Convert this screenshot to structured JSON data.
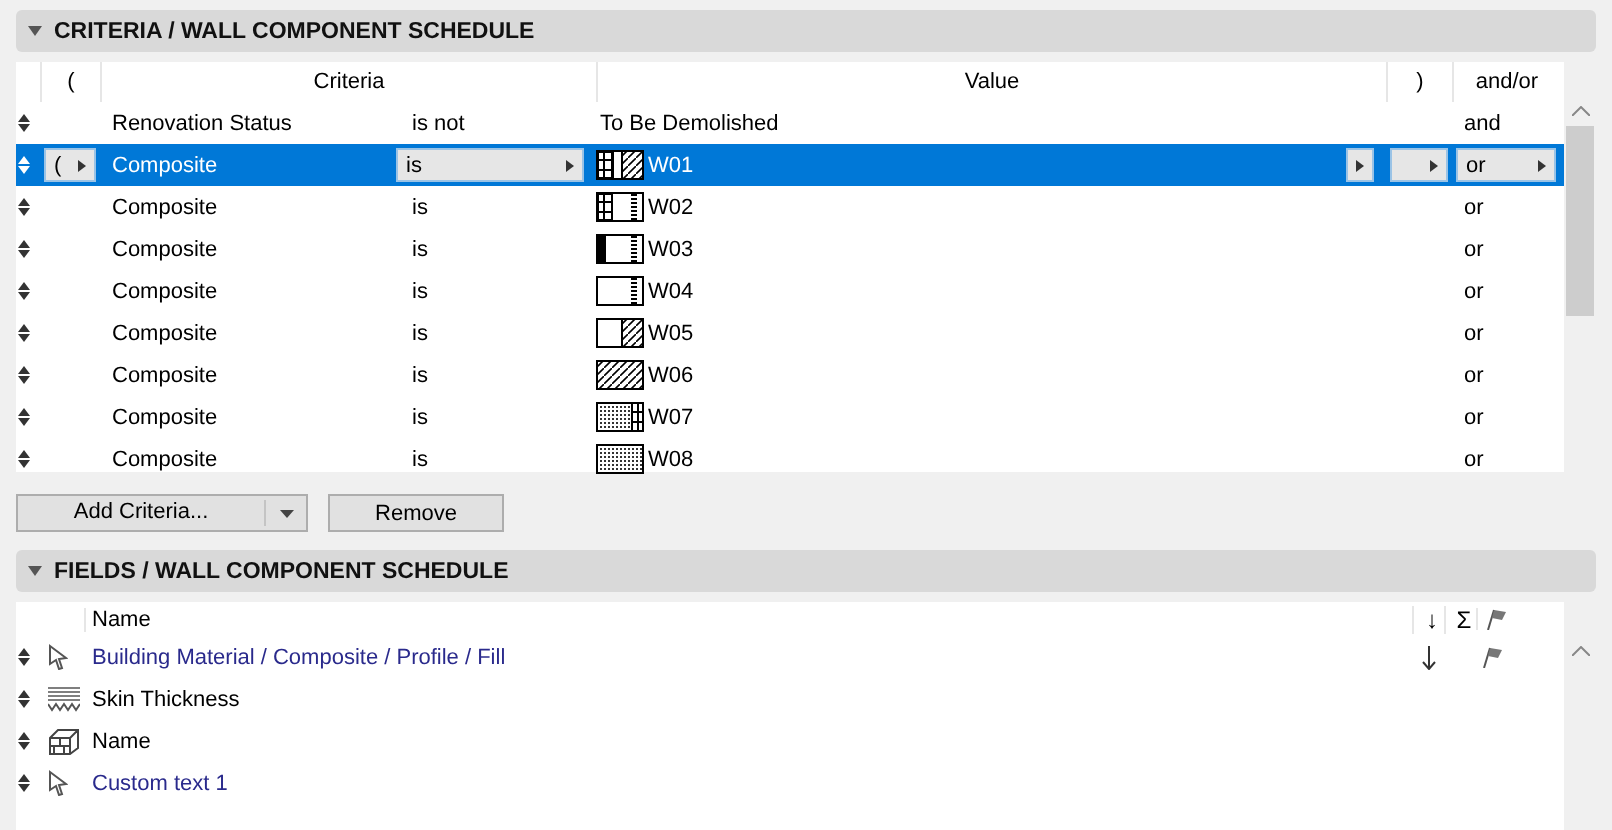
{
  "criteria_panel": {
    "title": "CRITERIA /  WALL COMPONENT SCHEDULE",
    "expanded": true,
    "columns": {
      "open_paren": "(",
      "criteria": "Criteria",
      "value": "Value",
      "close_paren": ")",
      "and_or": "and/or"
    },
    "rows": [
      {
        "open_paren": "",
        "criteria": "Renovation Status",
        "operator": "is not",
        "value": "To Be Demolished",
        "kind": "text",
        "close_paren": "",
        "and_or": "and",
        "selected": false
      },
      {
        "open_paren": "(",
        "criteria": "Composite",
        "operator": "is",
        "value": "W01",
        "kind": "swatch",
        "close_paren": "",
        "and_or": "or",
        "selected": true
      },
      {
        "open_paren": "",
        "criteria": "Composite",
        "operator": "is",
        "value": "W02",
        "kind": "swatch",
        "close_paren": "",
        "and_or": "or",
        "selected": false
      },
      {
        "open_paren": "",
        "criteria": "Composite",
        "operator": "is",
        "value": "W03",
        "kind": "swatch",
        "close_paren": "",
        "and_or": "or",
        "selected": false
      },
      {
        "open_paren": "",
        "criteria": "Composite",
        "operator": "is",
        "value": "W04",
        "kind": "swatch",
        "close_paren": "",
        "and_or": "or",
        "selected": false
      },
      {
        "open_paren": "",
        "criteria": "Composite",
        "operator": "is",
        "value": "W05",
        "kind": "swatch",
        "close_paren": "",
        "and_or": "or",
        "selected": false
      },
      {
        "open_paren": "",
        "criteria": "Composite",
        "operator": "is",
        "value": "W06",
        "kind": "swatch",
        "close_paren": "",
        "and_or": "or",
        "selected": false
      },
      {
        "open_paren": "",
        "criteria": "Composite",
        "operator": "is",
        "value": "W07",
        "kind": "swatch",
        "close_paren": "",
        "and_or": "or",
        "selected": false
      },
      {
        "open_paren": "",
        "criteria": "Composite",
        "operator": "is",
        "value": "W08",
        "kind": "swatch",
        "close_paren": "",
        "and_or": "or",
        "selected": false
      }
    ],
    "buttons": {
      "add": "Add Criteria...",
      "remove": "Remove"
    }
  },
  "fields_panel": {
    "title": "FIELDS /  WALL COMPONENT SCHEDULE",
    "expanded": true,
    "columns": {
      "name": "Name",
      "sort": "↓",
      "sum": "Σ"
    },
    "rows": [
      {
        "name": "Building Material / Composite / Profile / Fill",
        "kind": "pointer",
        "sorted": true,
        "flagged": true
      },
      {
        "name": "Skin Thickness",
        "kind": "skin",
        "sorted": false,
        "flagged": false
      },
      {
        "name": "Name",
        "kind": "brick",
        "sorted": false,
        "flagged": false
      },
      {
        "name": "Custom text 1",
        "kind": "pointer",
        "sorted": false,
        "flagged": false
      }
    ]
  }
}
